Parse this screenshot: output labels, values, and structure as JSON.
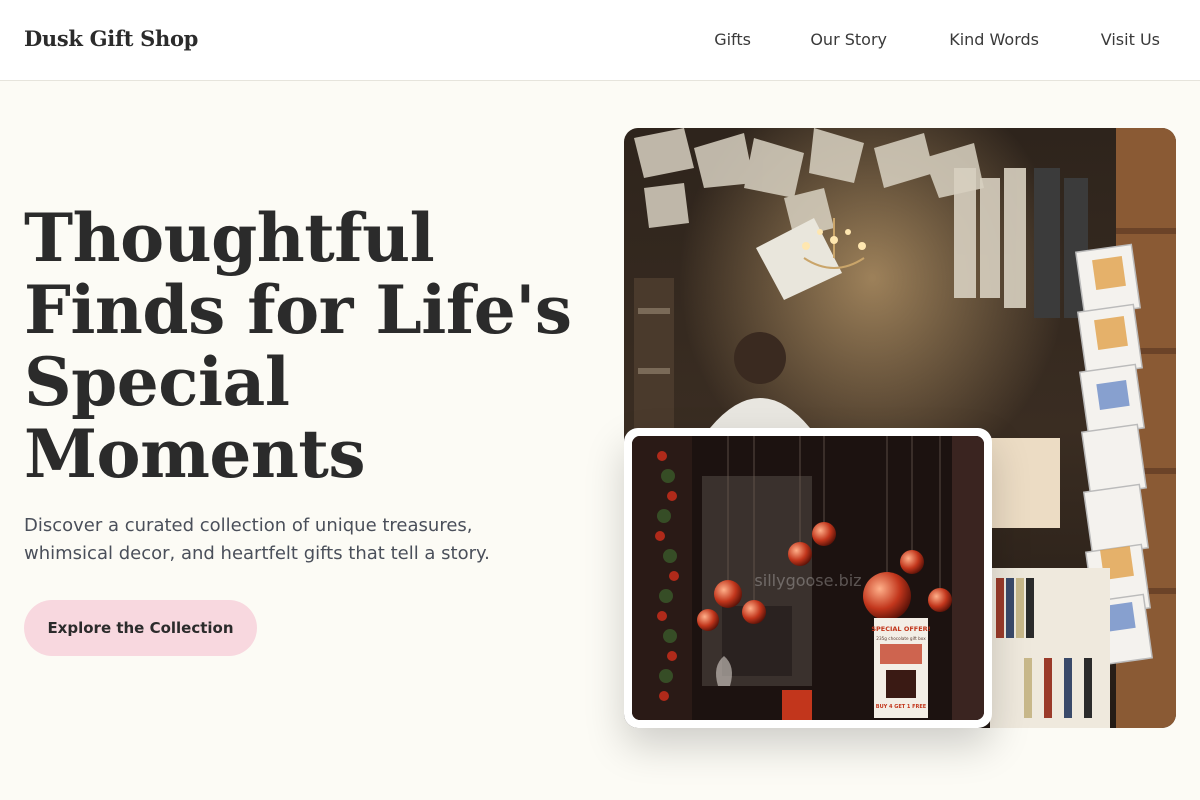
{
  "header": {
    "logo": "Dusk Gift Shop",
    "nav": [
      {
        "label": "Gifts"
      },
      {
        "label": "Our Story"
      },
      {
        "label": "Kind Words"
      },
      {
        "label": "Visit Us"
      }
    ]
  },
  "hero": {
    "title_lines": [
      "Thoughtful",
      "Finds for Life's",
      "Special",
      "Moments"
    ],
    "subtitle_lines": [
      "Discover a curated collection of unique treasures,",
      "whimsical decor, and heartfelt gifts that tell a story."
    ],
    "cta_label": "Explore the Collection"
  },
  "inset_photo": {
    "watermark": "sillygoose.biz",
    "sign_heading": "SPECIAL OFFER!",
    "sign_sub": "235g chocolate gift box",
    "sign_footer": "BUY 4 GET 1 FREE"
  },
  "colors": {
    "background": "#fcfbf5",
    "header_bg": "#ffffff",
    "text_dark": "#2b2b2b",
    "text_muted": "#4a4f5a",
    "cta_bg": "#f8d8df"
  }
}
